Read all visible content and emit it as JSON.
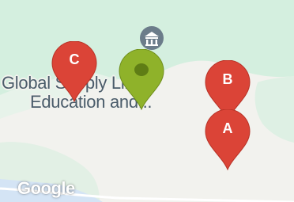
{
  "map": {
    "place_label_line1": "Global Supply Lines",
    "place_label_line2": "Education and...",
    "attribution": "Google",
    "poi_icon": "museum-icon",
    "colors": {
      "land": "#f2f2ee",
      "park": "#d4efdf",
      "water": "#d4e4f5",
      "marker_red": "#db4437",
      "marker_green": "#8fb22a",
      "poi_badge": "#6b7c8a"
    }
  },
  "markers": [
    {
      "id": "C",
      "label": "C"
    },
    {
      "id": "selected",
      "label": ""
    },
    {
      "id": "B",
      "label": "B"
    },
    {
      "id": "A",
      "label": "A"
    }
  ]
}
